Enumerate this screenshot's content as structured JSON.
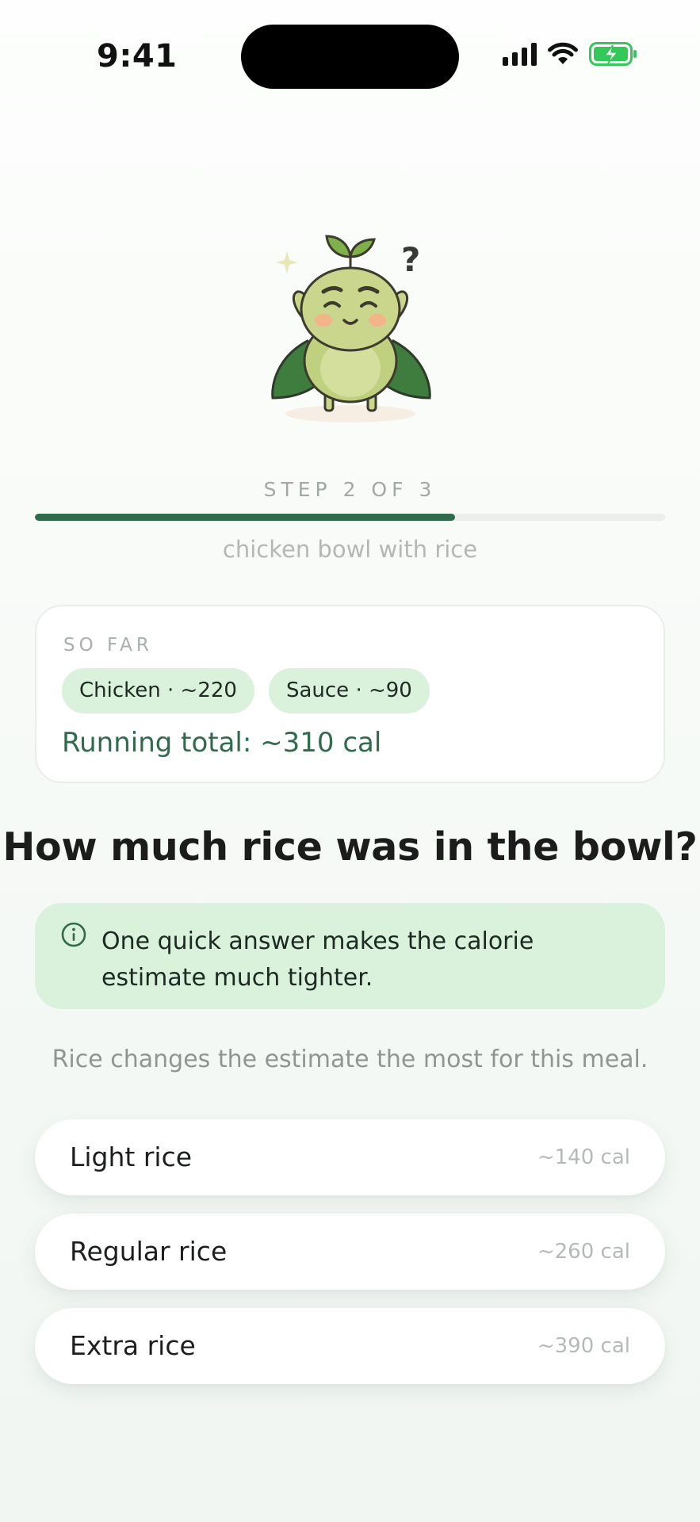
{
  "status_bar": {
    "time": "9:41"
  },
  "mascot": {
    "icon": "sprout-bean-mascot-icon"
  },
  "progress": {
    "step_label": "STEP 2 OF 3",
    "fraction": 0.667,
    "color": "#2f6b4c"
  },
  "meal": {
    "name": "chicken bowl with rice"
  },
  "so_far": {
    "title": "SO FAR",
    "items": [
      {
        "label": "Chicken · ~220"
      },
      {
        "label": "Sauce · ~90"
      }
    ],
    "running_total": "Running total: ~310 cal"
  },
  "question": {
    "text": "How much rice was in the bowl?"
  },
  "info": {
    "icon": "info-icon",
    "text": "One quick answer makes the calorie estimate much tighter."
  },
  "helper_text": "Rice changes the estimate the most for this meal.",
  "options": [
    {
      "label": "Light rice",
      "calories": "~140 cal"
    },
    {
      "label": "Regular rice",
      "calories": "~260 cal"
    },
    {
      "label": "Extra rice",
      "calories": "~390 cal"
    }
  ],
  "colors": {
    "accent": "#2f6b4c",
    "chip_bg": "#daf1dc"
  }
}
